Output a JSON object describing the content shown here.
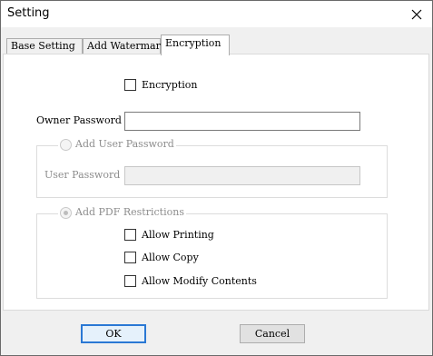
{
  "window": {
    "title": "Setting",
    "close_icon": "close-icon"
  },
  "tabs": [
    {
      "label": "Base Setting"
    },
    {
      "label": "Add Watermark"
    },
    {
      "label": "Encryption"
    }
  ],
  "encryption": {
    "enable_label": "Encryption",
    "enable_checked": false,
    "owner_password_label": "Owner Password",
    "owner_password_value": "",
    "user_password_option": "Add User Password",
    "user_password_label": "User Password",
    "user_password_value": "",
    "restrictions_option": "Add PDF Restrictions",
    "restrictions": [
      {
        "label": "Allow Printing",
        "checked": false
      },
      {
        "label": "Allow Copy",
        "checked": false
      },
      {
        "label": "Allow Modify Contents",
        "checked": false
      }
    ]
  },
  "buttons": {
    "ok": "OK",
    "cancel": "Cancel"
  }
}
